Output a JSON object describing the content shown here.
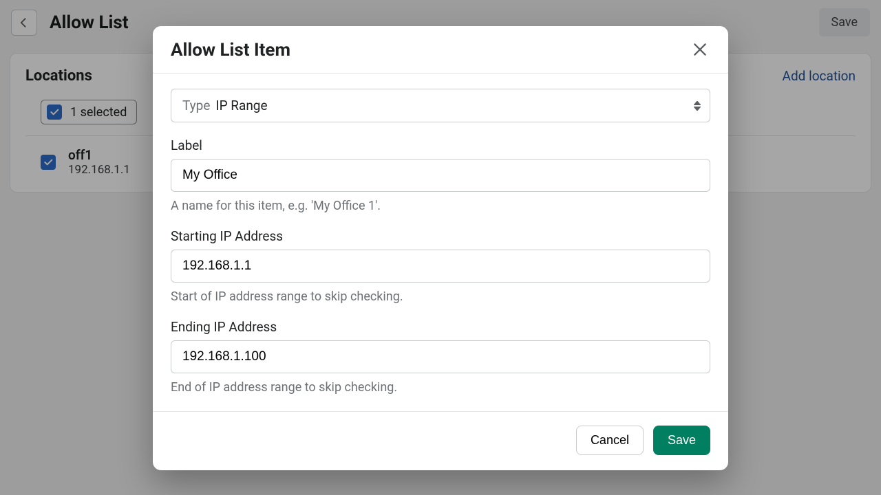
{
  "page": {
    "title": "Allow List",
    "save_label": "Save"
  },
  "card": {
    "title": "Locations",
    "add_link": "Add location",
    "selected_text": "1 selected",
    "items": [
      {
        "name": "off1",
        "ip": "192.168.1.1",
        "checked": true
      }
    ]
  },
  "modal": {
    "title": "Allow List Item",
    "type_label": "Type",
    "type_value": "IP Range",
    "label_field": {
      "label": "Label",
      "value": "My Office",
      "help": "A name for this item, e.g. 'My Office 1'."
    },
    "start_ip": {
      "label": "Starting IP Address",
      "value": "192.168.1.1",
      "help": "Start of IP address range to skip checking."
    },
    "end_ip": {
      "label": "Ending IP Address",
      "value": "192.168.1.100",
      "help": "End of IP address range to skip checking."
    },
    "cancel_label": "Cancel",
    "save_label": "Save"
  }
}
